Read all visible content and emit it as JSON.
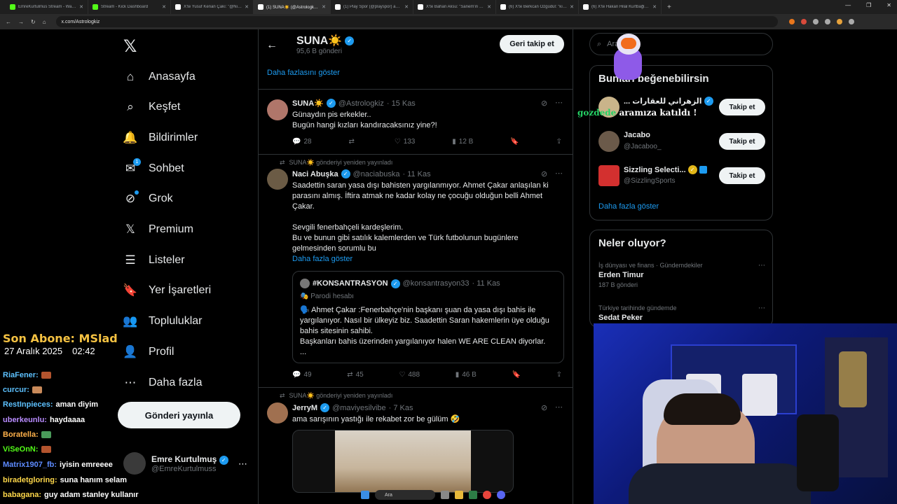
{
  "browser": {
    "tabs": [
      {
        "label": "EmreKurtulmus Stream - Watch",
        "color": "#53fc18",
        "active": false
      },
      {
        "label": "Stream - Kick Dashboard",
        "color": "#53fc18",
        "active": false
      },
      {
        "label": "X'te Yusuf Kenan Çakı: \"@Nicha...",
        "color": "#ffffff",
        "active": false
      },
      {
        "label": "(1) SUNA☀️ (@Astrologkiz) / X",
        "color": "#ffffff",
        "active": true
      },
      {
        "label": "(1) Play Spor (@playspor) adlı k...",
        "color": "#ffffff",
        "active": false
      },
      {
        "label": "X'te Bahan Aksu: \"Sanem'in bilik...",
        "color": "#ffffff",
        "active": false
      },
      {
        "label": "(6) X'te Berkcan Özgüdül: \"kızıl g...",
        "color": "#ffffff",
        "active": false
      },
      {
        "label": "(6) X'te Hakan Hilal Kurtbağlı: \"y...",
        "color": "#ffffff",
        "active": false
      }
    ],
    "url": "x.com/Astrologkiz"
  },
  "nav": {
    "items": [
      {
        "label": "Anasayfa",
        "icon": "home-icon",
        "glyph": "⌂"
      },
      {
        "label": "Keşfet",
        "icon": "search-icon",
        "glyph": "⌕"
      },
      {
        "label": "Bildirimler",
        "icon": "bell-icon",
        "glyph": "🔔"
      },
      {
        "label": "Sohbet",
        "icon": "mail-icon",
        "glyph": "✉"
      },
      {
        "label": "Grok",
        "icon": "grok-icon",
        "glyph": "⊘"
      },
      {
        "label": "Premium",
        "icon": "x-premium-icon",
        "glyph": "𝕏"
      },
      {
        "label": "Listeler",
        "icon": "list-icon",
        "glyph": "☰"
      },
      {
        "label": "Yer İşaretleri",
        "icon": "bookmark-icon",
        "glyph": "🔖"
      },
      {
        "label": "Topluluklar",
        "icon": "communities-icon",
        "glyph": "👥"
      },
      {
        "label": "Profil",
        "icon": "profile-icon",
        "glyph": "👤"
      },
      {
        "label": "Daha fazla",
        "icon": "more-circle-icon",
        "glyph": "⋯"
      }
    ],
    "sohbet_badge": "1",
    "post_button": "Gönderi yayınla",
    "account": {
      "name": "Emre Kurtulmuş",
      "handle": "@EmreKurtulmuss"
    }
  },
  "profile": {
    "name": "SUNA☀️",
    "posts": "95,6 B gönderi",
    "follow_back": "Geri takip et",
    "show_more": "Daha fazlasını göster"
  },
  "tweets": [
    {
      "name": "SUNA☀️",
      "handle": "@Astrologkiz",
      "time": "· 15 Kas",
      "lines": [
        "Günaydın pis erkekler..",
        "Bugün hangi kızları kandıracaksınız yine?!"
      ],
      "replies": "28",
      "reposts": "",
      "likes": "133",
      "views": "12 B"
    },
    {
      "repost_by": "SUNA☀️ gönderiyi yeniden yayınladı",
      "name": "Naci Abuşka",
      "handle": "@naciabuska",
      "time": "· 11 Kas",
      "lines": [
        "Saadettin saran yasa dışı bahisten yargılanmıyor. Ahmet Çakar anlaşılan ki parasını almış. İftira atmak ne kadar kolay ne çocuğu olduğun belli Ahmet Çakar.",
        "Sevgili fenerbahçeli kardeşlerim.",
        "Bu ve bunun gibi satılık kalemlerden ve Türk futbolunun bugünlere gelmesinden sorumlu bu"
      ],
      "show_more": "Daha fazla göster",
      "quote": {
        "name": "#KONSANTRASYON",
        "handle": "@konsantrasyon33",
        "time": "· 11 Kas",
        "parody": "Parodi hesabı",
        "text": "🗣️ Ahmet Çakar :Fenerbahçe'nin başkanı şuan da yasa dışı bahis ile yargılanıyor. Nasıl bir ülkeyiz biz. Saadettin Saran hakemlerin üye olduğu bahis sitesinin sahibi.",
        "text2": "Başkanları bahis üzerinden yargılanıyor halen WE ARE CLEAN diyorlar.",
        "text3": "..."
      },
      "replies": "49",
      "reposts": "45",
      "likes": "488",
      "views": "46 B"
    },
    {
      "repost_by": "SUNA☀️ gönderiyi yeniden yayınladı",
      "name": "JerryM",
      "handle": "@maviyesilvibe",
      "time": "· 7 Kas",
      "lines": [
        "ama sarışının yastığı ile rekabet zor be gülüm 🤣"
      ]
    }
  ],
  "right": {
    "search_placeholder": "Ara",
    "who_title": "Bunları beğenebilirsin",
    "suggestions": [
      {
        "name": "... الزهراني للعقارات",
        "handle": "",
        "button": "Takip et",
        "avatar": "#c9b48a"
      },
      {
        "name": "Jacabo",
        "handle": "@Jacaboo_",
        "button": "Takip et",
        "avatar": "#6b5a4a"
      },
      {
        "name": "Sizzling Selecti...",
        "handle": "@SizzlingSports",
        "button": "Takip et",
        "avatar": "#d3302f"
      }
    ],
    "show_more": "Daha fazla göster",
    "trends_title": "Neler oluyor?",
    "trends": [
      {
        "category": "İş dünyası ve finans · Gündemdekiler",
        "name": "Erden Timur",
        "posts": "187 B gönderi"
      },
      {
        "category": "Türkiye tarihinde gündemde",
        "name": "Sedat Peker",
        "posts": ""
      }
    ]
  },
  "overlay": {
    "last_sub": "Son Abone: MSlad",
    "date": "27 Aralık 2025",
    "time": "02:42",
    "join_user": "gozdede",
    "join_text": "aramıza katıldı !",
    "chat": [
      {
        "user": "RiaFener:",
        "msg": "",
        "color": "#5dc1ff",
        "emote": "#b3542e"
      },
      {
        "user": "curcur:",
        "msg": "",
        "color": "#5dc1ff",
        "emote": "#c98a5a"
      },
      {
        "user": "RestInpieces:",
        "msg": "aman diyim",
        "color": "#5dc1ff",
        "emote": ""
      },
      {
        "user": "uberkeunlu:",
        "msg": "haydaaaa",
        "color": "#b98cff",
        "emote": ""
      },
      {
        "user": "Boratella:",
        "msg": "",
        "color": "#ffb14a",
        "emote": "#4a9a5a"
      },
      {
        "user": "ViSeOnN:",
        "msg": "",
        "color": "#53fc18",
        "emote": "#b3542e"
      },
      {
        "user": "Matrix1907_fb:",
        "msg": "iyisin emreeee",
        "color": "#5d8bff",
        "emote": ""
      },
      {
        "user": "biradetgloring:",
        "msg": "suna hanım selam",
        "color": "#ffd84a",
        "emote": ""
      },
      {
        "user": "babagana:",
        "msg": "guy adam stanley kullanır",
        "color": "#ffd84a",
        "emote": ""
      }
    ]
  },
  "taskbar": {
    "search": "Ara"
  }
}
